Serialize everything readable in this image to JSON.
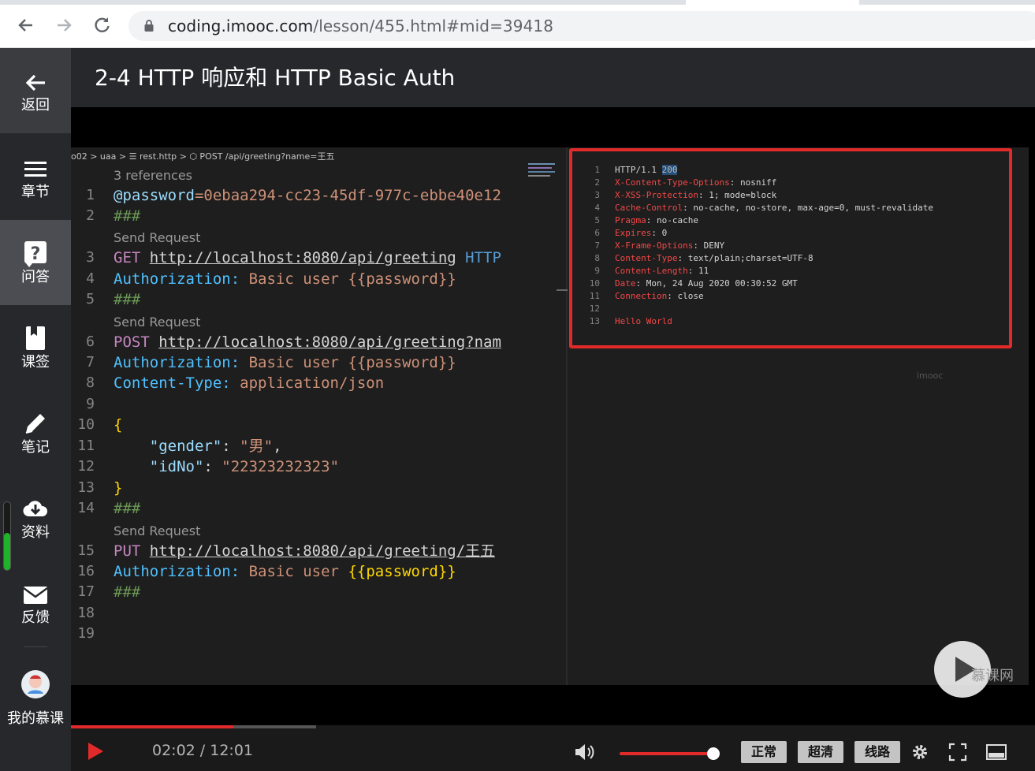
{
  "browser": {
    "url_host": "coding.imooc.com",
    "url_path": "/lesson/455.html#mid=39418"
  },
  "sidebar": {
    "items": [
      {
        "label": "返回"
      },
      {
        "label": "章节"
      },
      {
        "label": "问答"
      },
      {
        "label": "课签"
      },
      {
        "label": "笔记"
      },
      {
        "label": "资料"
      },
      {
        "label": "反馈"
      },
      {
        "label": "我的慕课"
      }
    ],
    "download_progress": 0.55
  },
  "lesson": {
    "title": "2-4 HTTP 响应和 HTTP Basic Auth"
  },
  "editor": {
    "breadcrumb": "o02 > uaa > ☰ rest.http > ⬡ POST /api/greeting?name=王五",
    "references_lens": "3 references",
    "send_request_lens": "Send Request",
    "line_numbers": [
      "1",
      "2",
      "3",
      "4",
      "5",
      "6",
      "7",
      "8",
      "9",
      "10",
      "11",
      "12",
      "13",
      "14",
      "15",
      "16",
      "17",
      "18",
      "19"
    ],
    "lines": {
      "l1_var": "@password",
      "l1_val": "=0ebaa294-cc23-45df-977c-ebbe40e12",
      "hash": "###",
      "l3_method": "GET",
      "l3_url": "http://localhost:8080/api/greeting",
      "l3_http": " HTTP",
      "auth_key": "Authorization:",
      "auth_val": " Basic user ",
      "auth_tpl": "{{password}}",
      "l6_method": "POST",
      "l6_url": "http://localhost:8080/api/greeting?nam",
      "l8_key": "Content-Type:",
      "l8_val": " application/json",
      "l10": "{",
      "l11_key": "\"gender\"",
      "l11_colon": ": ",
      "l11_val": "\"男\"",
      "l11_comma": ",",
      "l12_key": "\"idNo\"",
      "l12_colon": ": ",
      "l12_val": "\"22323232323\"",
      "l13": "}",
      "l15_method": "PUT",
      "l15_url": "http://localhost:8080/api/greeting/王五"
    }
  },
  "response": {
    "line_numbers": [
      "1",
      "2",
      "3",
      "4",
      "5",
      "6",
      "7",
      "8",
      "9",
      "10",
      "11",
      "12",
      "13"
    ],
    "status_line": "HTTP/1.1 ",
    "status_code": "200",
    "headers": [
      {
        "k": "X-Content-Type-Options",
        "v": ": nosniff"
      },
      {
        "k": "X-XSS-Protection",
        "v": ": 1; mode=block"
      },
      {
        "k": "Cache-Control",
        "v": ": no-cache, no-store, max-age=0, must-revalidate"
      },
      {
        "k": "Pragma",
        "v": ": no-cache"
      },
      {
        "k": "Expires",
        "v": ": 0"
      },
      {
        "k": "X-Frame-Options",
        "v": ": DENY"
      },
      {
        "k": "Content-Type",
        "v": ": text/plain;charset=UTF-8"
      },
      {
        "k": "Content-Length",
        "v": ": 11"
      },
      {
        "k": "Date",
        "v": ": Mon, 24 Aug 2020 00:30:52 GMT"
      },
      {
        "k": "Connection",
        "v": ": close"
      }
    ],
    "body": "Hello World"
  },
  "video": {
    "watermark": "imooc",
    "brand": "慕课网",
    "time": "02:02 / 12:01",
    "progress": 0.1686,
    "buffered": 0.2545,
    "volume": 1.0
  },
  "controls": {
    "normal": "正常",
    "hd": "超清",
    "route": "线路"
  }
}
